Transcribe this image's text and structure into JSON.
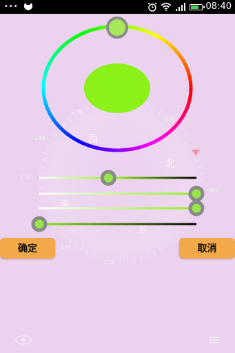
{
  "statusbar": {
    "time": "08:40",
    "icons": [
      "dots-icon",
      "cat-icon",
      "alarm-icon",
      "wifi-icon",
      "signal-icon",
      "battery-icon"
    ]
  },
  "compass": {
    "directions": {
      "west": "西",
      "north": "北",
      "south": "南",
      "east": "东"
    },
    "degrees": [
      "270",
      "330",
      "240",
      "210",
      "300",
      "150",
      "120"
    ]
  },
  "color_picker": {
    "selected_color": "#8cf019",
    "wheel_knob_color": "#a6e85a"
  },
  "sliders": [
    {
      "name": "slider-1",
      "value": 0.44,
      "gradient": [
        "#ffffff",
        "#8cf019",
        "#000000"
      ]
    },
    {
      "name": "slider-2",
      "value": 1.0,
      "gradient": [
        "#ffffff",
        "#8cf019"
      ]
    },
    {
      "name": "slider-3",
      "value": 1.0,
      "gradient": [
        "#ffffff",
        "#8cf019"
      ]
    },
    {
      "name": "slider-4",
      "value": 0.0,
      "gradient": [
        "#8cf019",
        "#000000"
      ]
    }
  ],
  "buttons": {
    "confirm": "确定",
    "cancel": "取消"
  },
  "colors": {
    "background": "#ebd2ef",
    "button": "#f3a84a",
    "knob": "#8a8a8a"
  }
}
